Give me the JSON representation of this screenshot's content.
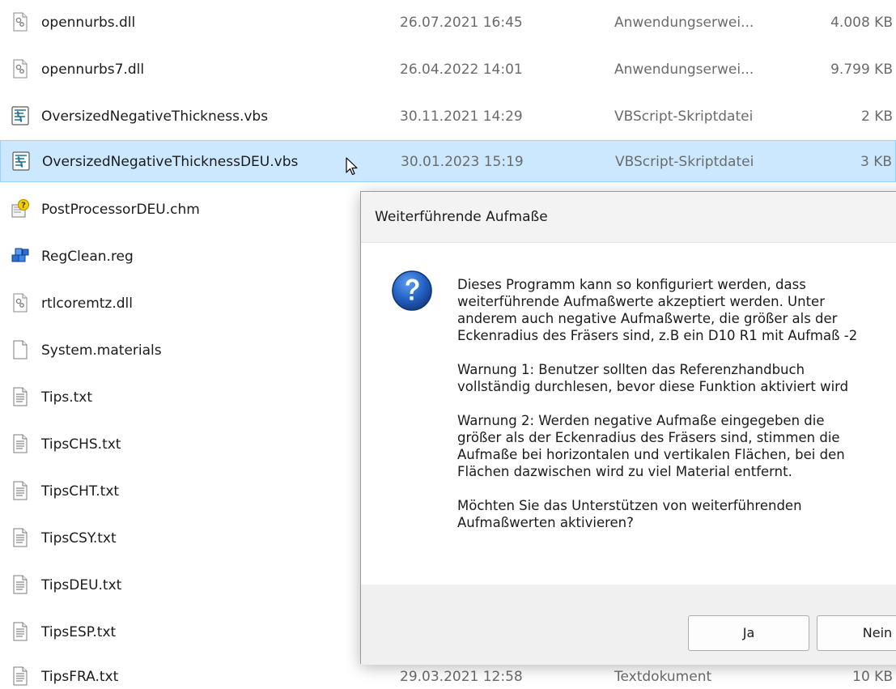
{
  "files": [
    {
      "name": "opennurbs.dll",
      "date": "26.07.2021 16:45",
      "type": "Anwendungserwei...",
      "size": "4.008 KB",
      "icon": "dll-icon"
    },
    {
      "name": "opennurbs7.dll",
      "date": "26.04.2022 14:01",
      "type": "Anwendungserwei...",
      "size": "9.799 KB",
      "icon": "dll-icon"
    },
    {
      "name": "OversizedNegativeThickness.vbs",
      "date": "30.11.2021 14:29",
      "type": "VBScript-Skriptdatei",
      "size": "2 KB",
      "icon": "vbs-script-icon"
    },
    {
      "name": "OversizedNegativeThicknessDEU.vbs",
      "date": "30.01.2023 15:19",
      "type": "VBScript-Skriptdatei",
      "size": "3 KB",
      "icon": "vbs-script-icon"
    },
    {
      "name": "PostProcessorDEU.chm",
      "date": "",
      "type": "",
      "size": "",
      "icon": "chm-help-icon"
    },
    {
      "name": "RegClean.reg",
      "date": "",
      "type": "",
      "size": "",
      "icon": "registry-icon"
    },
    {
      "name": "rtlcoremtz.dll",
      "date": "",
      "type": "",
      "size": "",
      "icon": "dll-icon"
    },
    {
      "name": "System.materials",
      "date": "",
      "type": "",
      "size": "",
      "icon": "blank-file-icon"
    },
    {
      "name": "Tips.txt",
      "date": "",
      "type": "",
      "size": "",
      "icon": "text-file-icon"
    },
    {
      "name": "TipsCHS.txt",
      "date": "",
      "type": "",
      "size": "",
      "icon": "text-file-icon"
    },
    {
      "name": "TipsCHT.txt",
      "date": "",
      "type": "",
      "size": "",
      "icon": "text-file-icon"
    },
    {
      "name": "TipsCSY.txt",
      "date": "",
      "type": "",
      "size": "",
      "icon": "text-file-icon"
    },
    {
      "name": "TipsDEU.txt",
      "date": "",
      "type": "",
      "size": "",
      "icon": "text-file-icon"
    },
    {
      "name": "TipsESP.txt",
      "date": "",
      "type": "",
      "size": "",
      "icon": "text-file-icon"
    },
    {
      "name": "TipsFRA.txt",
      "date": "29.03.2021 12:58",
      "type": "Textdokument",
      "size": "10 KB",
      "icon": "text-file-icon"
    }
  ],
  "selected_file": "OversizedNegativeThicknessDEU.vbs",
  "dialog": {
    "title": "Weiterführende Aufmaße",
    "icon": "question-icon",
    "paragraphs": [
      "Dieses Programm kann so konfiguriert werden, dass\nweiterführende Aufmaßwerte akzeptiert werden. Unter\nanderem auch negative Aufmaßwerte, die größer als der\nEckenradius des Fräsers sind, z.B ein D10 R1 mit Aufmaß -2",
      "Warnung 1: Benutzer sollten das Referenzhandbuch\nvollständig durchlesen, bevor diese Funktion aktiviert wird",
      "Warnung 2: Werden negative Aufmaße eingegeben die\ngrößer als der Eckenradius des Fräsers sind, stimmen die\nAufmaße bei horizontalen und vertikalen Flächen, bei den\nFlächen dazwischen wird zu viel Material entfernt.",
      "Möchten Sie das Unterstützen von weiterführenden\nAufmaßwerten aktivieren?"
    ],
    "yes_label": "Ja",
    "no_label": "Nein"
  },
  "colors": {
    "selection_bg": "#cce8ff",
    "selection_border": "#99d1ff",
    "question_icon": "#1f5fb5"
  }
}
